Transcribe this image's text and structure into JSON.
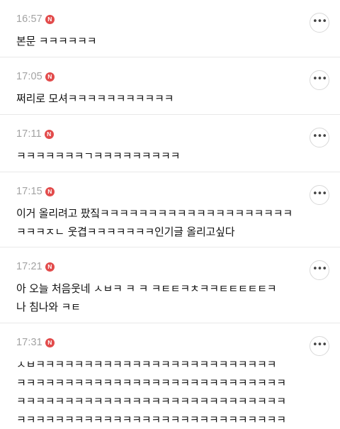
{
  "comments": [
    {
      "time": "16:57",
      "badge": "N",
      "text": "본문 ㅋㅋㅋㅋㅋㅋ",
      "more_icon": "ellipsis-icon"
    },
    {
      "time": "17:05",
      "badge": "N",
      "text": "쩌리로 모셔ㅋㅋㅋㅋㅋㅋㅋㅋㅋㅋㅋ",
      "more_icon": "ellipsis-icon"
    },
    {
      "time": "17:11",
      "badge": "N",
      "text": "ㅋㅋㅋㅋㅋㅋㅋㄱㅋㅋㅋㅋㅋㅋㅋㅋㅋ",
      "more_icon": "ellipsis-icon"
    },
    {
      "time": "17:15",
      "badge": "N",
      "text": "이거 올리려고 팠짘ㅋㅋㅋㅋㅋㅋㅋㅋㅋㅋㅋㅋㅋㅋㅋㅋㅋㅋㅋㅋ\nㅋㅋㅋㅈㄴ 웃겹ㅋㅋㅋㅋㅋㅋㅋ인기글 올리고싶다",
      "more_icon": "ellipsis-icon"
    },
    {
      "time": "17:21",
      "badge": "N",
      "text": "아 오늘 처음웃네 ㅅㅂㅋ ㅋ ㅋ ㅋㅌㅌㅋㅊㅋㅋㅌㅌㅌㅌㅌㅋ\n나 침나와 ㅋㅌ",
      "more_icon": "ellipsis-icon"
    },
    {
      "time": "17:31",
      "badge": "N",
      "text": "ㅅㅂㅋㅋㅋㅋㅋㅋㅋㅋㅋㅋㅋㅋㅋㅋㅋㅋㅋㅋㅋㅋㅋㅋㅋㅋㅋ\nㅋㅋㅋㅋㅋㅋㅋㅋㅋㅋㅋㅋㅋㅋㅋㅋㅋㅋㅋㅋㅋㅋㅋㅋㅋㅋㅋㅋ\nㅋㅋㅋㅋㅋㅋㅋㅋㅋㅋㅋㅋㅋㅋㅋㅋㅋㅋㅋㅋㅋㅋㅋㅋㅋㅋㅋㅋ\nㅋㅋㅋㅋㅋㅋㅋㅋㅋㅋㅋㅋㅋㅋㅋㅋㅋㅋㅋㅋㅋㅋㅋㅋㅋㅋㅋㅋ",
      "more_icon": "ellipsis-icon"
    }
  ],
  "colors": {
    "time": "#a3a3a3",
    "badge": "#e24b4b",
    "divider": "#e9e9e9",
    "text": "#111111"
  }
}
